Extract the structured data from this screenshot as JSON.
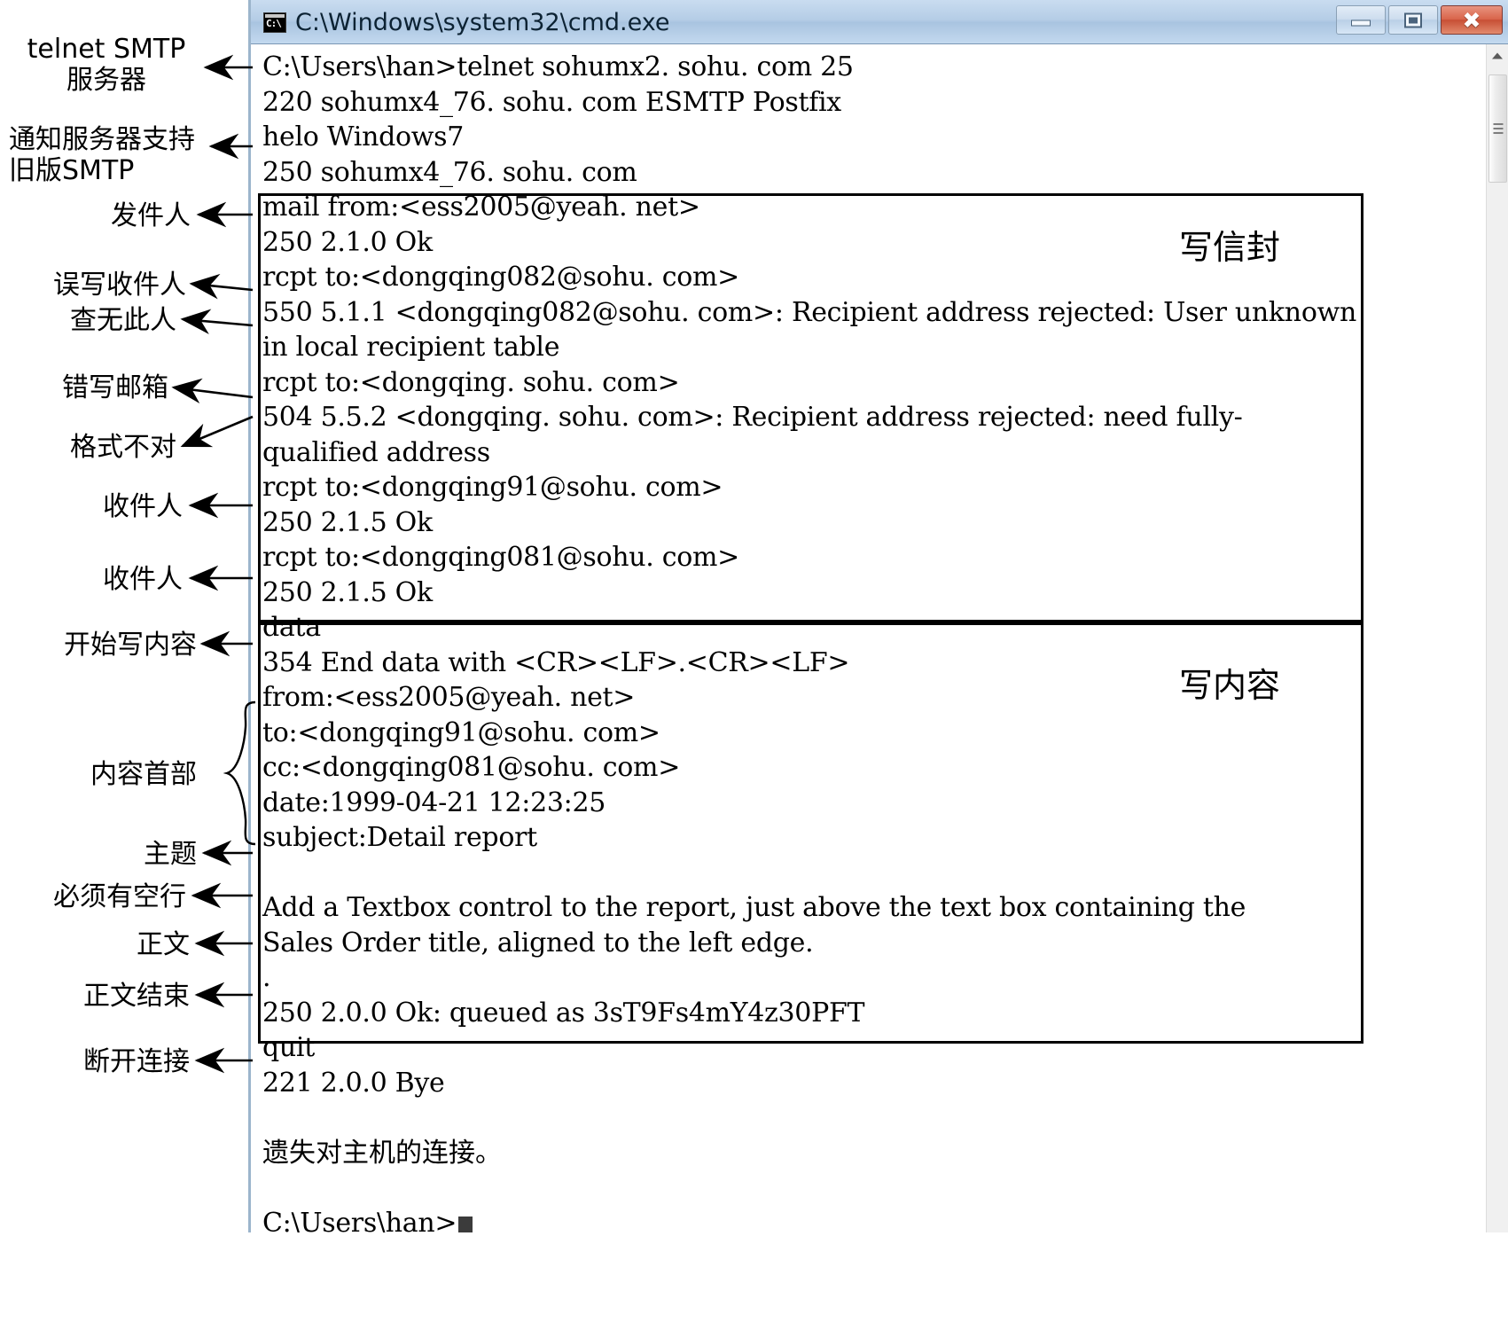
{
  "window": {
    "title": "C:\\Windows\\system32\\cmd.exe",
    "icon": "cmd-icon",
    "controls": {
      "minimize": "minimize-button",
      "maximize": "maximize-button",
      "close": "close-button"
    }
  },
  "console": {
    "lines": [
      "C:\\Users\\han>telnet sohumx2. sohu. com 25",
      "220 sohumx4_76. sohu. com ESMTP Postfix",
      "helo Windows7",
      "250 sohumx4_76. sohu. com",
      "mail from:<ess2005@yeah. net>",
      "250 2.1.0 Ok",
      "rcpt to:<dongqing082@sohu. com>",
      "550 5.1.1 <dongqing082@sohu. com>: Recipient address rejected: User unknown",
      "in local recipient table",
      "rcpt to:<dongqing. sohu. com>",
      "504 5.5.2 <dongqing. sohu. com>: Recipient address rejected: need fully-",
      "qualified address",
      "rcpt to:<dongqing91@sohu. com>",
      "250 2.1.5 Ok",
      "rcpt to:<dongqing081@sohu. com>",
      "250 2.1.5 Ok",
      "data",
      "354 End data with <CR><LF>.<CR><LF>",
      "from:<ess2005@yeah. net>",
      "to:<dongqing91@sohu. com>",
      "cc:<dongqing081@sohu. com>",
      "date:1999-04-21 12:23:25",
      "subject:Detail report",
      "",
      "Add a Textbox control to the report, just above the text box containing the",
      "Sales Order title, aligned to the left edge.",
      ".",
      "250 2.0.0 Ok: queued as 3sT9Fs4mY4z30PFT",
      "quit",
      "221 2.0.0 Bye",
      "",
      "遗失对主机的连接。",
      "",
      "C:\\Users\\han>"
    ],
    "prompt_cursor": "block-cursor"
  },
  "sections": [
    {
      "label": "写信封",
      "name": "envelope-section-label"
    },
    {
      "label": "写内容",
      "name": "content-section-label"
    }
  ],
  "annotations": [
    {
      "id": "a1",
      "text": "telnet SMTP\n服务器",
      "name": "annotation-telnet-smtp-server"
    },
    {
      "id": "a2",
      "text": "通知服务器支持\n旧版SMTP",
      "name": "annotation-notify-legacy-smtp"
    },
    {
      "id": "a3",
      "text": "发件人",
      "name": "annotation-sender"
    },
    {
      "id": "a4",
      "text": "误写收件人",
      "name": "annotation-wrong-recipient"
    },
    {
      "id": "a5",
      "text": "查无此人",
      "name": "annotation-user-unknown"
    },
    {
      "id": "a6",
      "text": "错写邮箱",
      "name": "annotation-wrong-mailbox"
    },
    {
      "id": "a7",
      "text": "格式不对",
      "name": "annotation-bad-format"
    },
    {
      "id": "a8",
      "text": "收件人",
      "name": "annotation-recipient-1"
    },
    {
      "id": "a9",
      "text": "收件人",
      "name": "annotation-recipient-2"
    },
    {
      "id": "a10",
      "text": "开始写内容",
      "name": "annotation-start-content"
    },
    {
      "id": "a11",
      "text": "内容首部",
      "name": "annotation-content-header"
    },
    {
      "id": "a12",
      "text": "主题",
      "name": "annotation-subject"
    },
    {
      "id": "a13",
      "text": "必须有空行",
      "name": "annotation-blank-line-required"
    },
    {
      "id": "a14",
      "text": "正文",
      "name": "annotation-body"
    },
    {
      "id": "a15",
      "text": "正文结束",
      "name": "annotation-body-end"
    },
    {
      "id": "a16",
      "text": "断开连接",
      "name": "annotation-disconnect"
    }
  ],
  "colors": {
    "title_bar": "#b5cde6",
    "close_button": "#d9644a",
    "console_bg": "#ffffff",
    "console_text": "#000000",
    "annotation_text": "#000000",
    "box_border": "#000000"
  }
}
